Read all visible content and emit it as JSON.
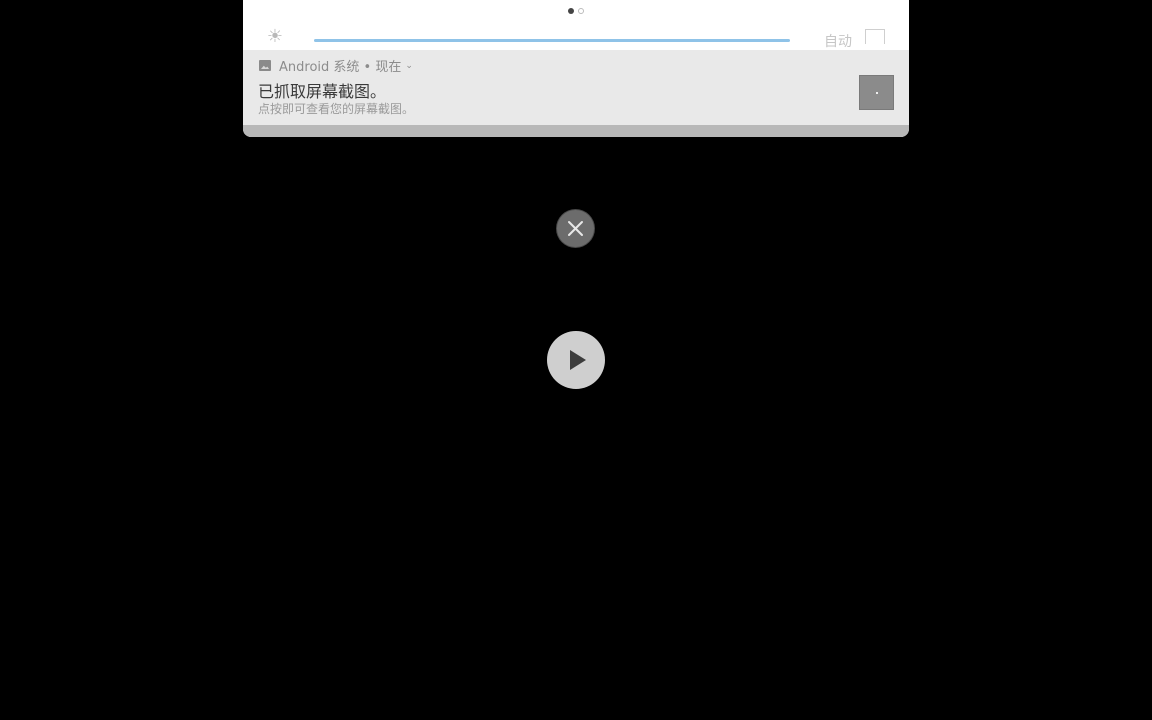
{
  "quick_settings": {
    "auto_label": "自动",
    "page_dots": [
      "active",
      "inactive"
    ]
  },
  "notification": {
    "app_name": "Android 系统",
    "separator": " • ",
    "time": "现在",
    "title": "已抓取屏幕截图。",
    "text": "点按即可查看您的屏幕截图。"
  },
  "icons": {
    "brightness": "brightness-icon",
    "app": "image-icon",
    "expand": "chevron-down-icon",
    "close": "close-icon",
    "play": "play-icon"
  },
  "colors": {
    "background": "#000000",
    "notification_bg": "#e9e9e9",
    "slider": "#8fc3e8",
    "play_button": "#cfcfcf",
    "close_button": "#6c6c6c"
  }
}
